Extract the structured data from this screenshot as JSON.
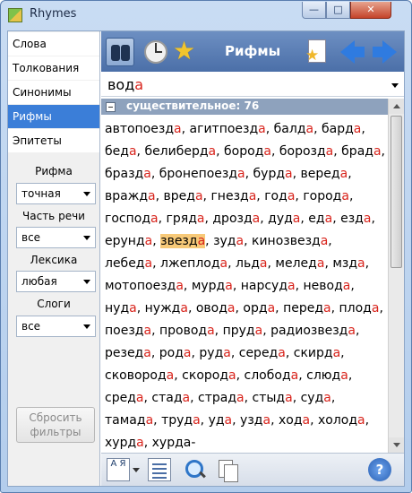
{
  "window": {
    "title": "Rhymes",
    "minimize": "—",
    "maximize": "□",
    "close": "✕"
  },
  "sidebar": {
    "items": [
      {
        "label": "Слова"
      },
      {
        "label": "Толкования"
      },
      {
        "label": "Синонимы"
      },
      {
        "label": "Рифмы",
        "active": true
      },
      {
        "label": "Эпитеты"
      }
    ],
    "filters": [
      {
        "label": "Рифма",
        "value": "точная"
      },
      {
        "label": "Часть речи",
        "value": "все"
      },
      {
        "label": "Лексика",
        "value": "любая"
      },
      {
        "label": "Слоги",
        "value": "все"
      }
    ],
    "reset_button": {
      "line1": "Сбросить",
      "line2": "фильтры"
    }
  },
  "toolbar": {
    "title": "Рифмы",
    "icons": [
      "binoculars-icon",
      "clock-icon",
      "star-icon",
      "favorite-document-icon",
      "back-arrow-icon",
      "forward-arrow-icon"
    ]
  },
  "search": {
    "stem": "вод",
    "ending": "а"
  },
  "results": {
    "group_title": "существительное: 76",
    "selected": "звезда",
    "words": [
      [
        "автопоезд",
        "а"
      ],
      [
        "агитпоезд",
        "а"
      ],
      [
        "балд",
        "а"
      ],
      [
        "бард",
        "а"
      ],
      [
        "бед",
        "а"
      ],
      [
        "белиберд",
        "а"
      ],
      [
        "бород",
        "а"
      ],
      [
        "борозд",
        "а"
      ],
      [
        "брад",
        "а"
      ],
      [
        "бразд",
        "а"
      ],
      [
        "бронепоезд",
        "а"
      ],
      [
        "бурд",
        "а"
      ],
      [
        "веред",
        "а"
      ],
      [
        "вражд",
        "а"
      ],
      [
        "вред",
        "а"
      ],
      [
        "гнезд",
        "а"
      ],
      [
        "год",
        "а"
      ],
      [
        "город",
        "а"
      ],
      [
        "господ",
        "а"
      ],
      [
        "гряд",
        "а"
      ],
      [
        "дрозд",
        "а"
      ],
      [
        "дуд",
        "а"
      ],
      [
        "ед",
        "а"
      ],
      [
        "езд",
        "а"
      ],
      [
        "ерунд",
        "а"
      ],
      [
        "звезд",
        "а"
      ],
      [
        "зуд",
        "а"
      ],
      [
        "кинозвезд",
        "а"
      ],
      [
        "лебед",
        "а"
      ],
      [
        "лжеплод",
        "а"
      ],
      [
        "льд",
        "а"
      ],
      [
        "мелед",
        "а"
      ],
      [
        "мзд",
        "а"
      ],
      [
        "мотопоезд",
        "а"
      ],
      [
        "мурд",
        "а"
      ],
      [
        "нарсуд",
        "а"
      ],
      [
        "невод",
        "а"
      ],
      [
        "нуд",
        "а"
      ],
      [
        "нужд",
        "а"
      ],
      [
        "овод",
        "а"
      ],
      [
        "орд",
        "а"
      ],
      [
        "перед",
        "а"
      ],
      [
        "плод",
        "а"
      ],
      [
        "поезд",
        "а"
      ],
      [
        "провод",
        "а"
      ],
      [
        "пруд",
        "а"
      ],
      [
        "радиозвезд",
        "а"
      ],
      [
        "резед",
        "а"
      ],
      [
        "род",
        "а"
      ],
      [
        "руд",
        "а"
      ],
      [
        "серед",
        "а"
      ],
      [
        "скирд",
        "а"
      ],
      [
        "сковород",
        "а"
      ],
      [
        "скород",
        "а"
      ],
      [
        "слобод",
        "а"
      ],
      [
        "слюд",
        "а"
      ],
      [
        "сред",
        "а"
      ],
      [
        "стад",
        "а"
      ],
      [
        "страд",
        "а"
      ],
      [
        "стыд",
        "а"
      ],
      [
        "суд",
        "а"
      ],
      [
        "тамад",
        "а"
      ],
      [
        "труд",
        "а"
      ],
      [
        "уд",
        "а"
      ],
      [
        "узд",
        "а"
      ],
      [
        "ход",
        "а"
      ],
      [
        "холод",
        "а"
      ],
      [
        "хурд",
        "а"
      ],
      [
        "хурда-",
        ""
      ]
    ]
  },
  "bottombar": {
    "sort_label": "А Я",
    "help_label": "?",
    "icons": [
      "sort-icon",
      "list-view-icon",
      "zoom-icon",
      "copy-icon",
      "help-icon"
    ]
  }
}
